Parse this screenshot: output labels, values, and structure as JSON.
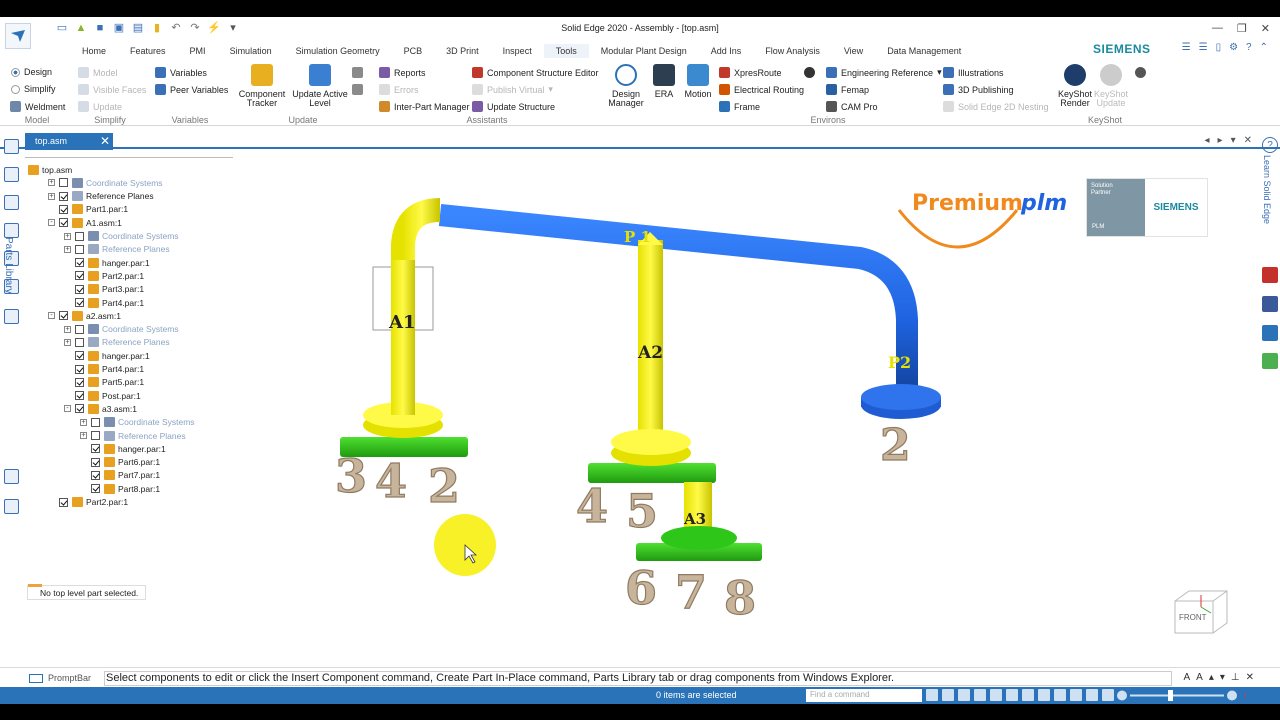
{
  "window": {
    "title": "Solid Edge 2020 - Assembly - [top.asm]"
  },
  "brand": {
    "name": "SIEMENS"
  },
  "tabs": [
    "Home",
    "Features",
    "PMI",
    "Simulation",
    "Simulation Geometry",
    "PCB",
    "3D Print",
    "Inspect",
    "Tools",
    "Modular Plant Design",
    "Add Ins",
    "Flow Analysis",
    "View",
    "Data Management"
  ],
  "active_tab": "Tools",
  "ribbon": {
    "model": {
      "design": "Design",
      "simplify": "Simplify",
      "weldment": "Weldment",
      "group": "Model"
    },
    "simplify": {
      "model": "Model",
      "visible_faces": "Visible Faces",
      "update": "Update",
      "group": "Simplify"
    },
    "variables": {
      "variables": "Variables",
      "peer_variables": "Peer Variables",
      "group": "Variables"
    },
    "update": {
      "component_tracker": "Component Tracker",
      "update_active_level": "Update Active Level",
      "group": "Update"
    },
    "assistants": {
      "reports": "Reports",
      "errors": "Errors",
      "inter_part_manager": "Inter-Part Manager",
      "cse": "Component Structure Editor",
      "publish_virtual": "Publish Virtual",
      "update_structure": "Update Structure",
      "group": "Assistants"
    },
    "environs": {
      "design_manager": "Design Manager",
      "era": "ERA",
      "motion": "Motion",
      "xpresroute": "XpresRoute",
      "electrical_routing": "Electrical Routing",
      "frame": "Frame",
      "engineering_reference": "Engineering Reference",
      "femap": "Femap",
      "cam_pro": "CAM Pro",
      "illustrations": "Illustrations",
      "publishing_3d": "3D Publishing",
      "nesting": "Solid Edge 2D Nesting",
      "group": "Environs"
    },
    "keyshot": {
      "render": "KeyShot Render",
      "update": "KeyShot Update",
      "group": "KeyShot"
    }
  },
  "document_tab": {
    "label": "top.asm"
  },
  "tree": [
    {
      "label": "top.asm",
      "level": 0,
      "checked": null,
      "expand": "",
      "grey": false,
      "icon": "asm"
    },
    {
      "label": "Coordinate Systems",
      "level": 1,
      "checked": false,
      "expand": "+",
      "grey": true,
      "icon": "cs"
    },
    {
      "label": "Reference Planes",
      "level": 1,
      "checked": true,
      "expand": "+",
      "grey": false,
      "icon": "rp"
    },
    {
      "label": "Part1.par:1",
      "level": 1,
      "checked": true,
      "expand": "",
      "grey": false,
      "icon": "part"
    },
    {
      "label": "A1.asm:1",
      "level": 1,
      "checked": true,
      "expand": "-",
      "grey": false,
      "icon": "asm"
    },
    {
      "label": "Coordinate Systems",
      "level": 2,
      "checked": false,
      "expand": "+",
      "grey": true,
      "icon": "cs"
    },
    {
      "label": "Reference Planes",
      "level": 2,
      "checked": false,
      "expand": "+",
      "grey": true,
      "icon": "rp"
    },
    {
      "label": "hanger.par:1",
      "level": 2,
      "checked": true,
      "expand": "",
      "grey": false,
      "icon": "part"
    },
    {
      "label": "Part2.par:1",
      "level": 2,
      "checked": true,
      "expand": "",
      "grey": false,
      "icon": "part"
    },
    {
      "label": "Part3.par:1",
      "level": 2,
      "checked": true,
      "expand": "",
      "grey": false,
      "icon": "part"
    },
    {
      "label": "Part4.par:1",
      "level": 2,
      "checked": true,
      "expand": "",
      "grey": false,
      "icon": "part"
    },
    {
      "label": "a2.asm:1",
      "level": 1,
      "checked": true,
      "expand": "-",
      "grey": false,
      "icon": "asm"
    },
    {
      "label": "Coordinate Systems",
      "level": 2,
      "checked": false,
      "expand": "+",
      "grey": true,
      "icon": "cs"
    },
    {
      "label": "Reference Planes",
      "level": 2,
      "checked": false,
      "expand": "+",
      "grey": true,
      "icon": "rp"
    },
    {
      "label": "hanger.par:1",
      "level": 2,
      "checked": true,
      "expand": "",
      "grey": false,
      "icon": "part"
    },
    {
      "label": "Part4.par:1",
      "level": 2,
      "checked": true,
      "expand": "",
      "grey": false,
      "icon": "part"
    },
    {
      "label": "Part5.par:1",
      "level": 2,
      "checked": true,
      "expand": "",
      "grey": false,
      "icon": "part"
    },
    {
      "label": "Post.par:1",
      "level": 2,
      "checked": true,
      "expand": "",
      "grey": false,
      "icon": "part"
    },
    {
      "label": "a3.asm:1",
      "level": 2,
      "checked": true,
      "expand": "-",
      "grey": false,
      "icon": "asm"
    },
    {
      "label": "Coordinate Systems",
      "level": 3,
      "checked": false,
      "expand": "+",
      "grey": true,
      "icon": "cs"
    },
    {
      "label": "Reference Planes",
      "level": 3,
      "checked": false,
      "expand": "+",
      "grey": true,
      "icon": "rp"
    },
    {
      "label": "hanger.par:1",
      "level": 3,
      "checked": true,
      "expand": "",
      "grey": false,
      "icon": "part"
    },
    {
      "label": "Part6.par:1",
      "level": 3,
      "checked": true,
      "expand": "",
      "grey": false,
      "icon": "part"
    },
    {
      "label": "Part7.par:1",
      "level": 3,
      "checked": true,
      "expand": "",
      "grey": false,
      "icon": "part"
    },
    {
      "label": "Part8.par:1",
      "level": 3,
      "checked": true,
      "expand": "",
      "grey": false,
      "icon": "part"
    },
    {
      "label": "Part2.par:1",
      "level": 1,
      "checked": true,
      "expand": "",
      "grey": false,
      "icon": "part"
    }
  ],
  "tree_status": "No top level part selected.",
  "side_labels": {
    "parts_library": "Parts Library",
    "learn": "Learn Solid Edge"
  },
  "model_labels": {
    "a1": "A1",
    "a2": "A2",
    "a3": "A3",
    "p1": "P 1",
    "p2": "P2",
    "n3": "3",
    "n4": "4",
    "n2": "2",
    "n4b": "4",
    "n5": "5",
    "n2b": "2",
    "n6": "6",
    "n7": "7",
    "n8": "8"
  },
  "partner_logo": {
    "premium": "Premium",
    "plm": "plm",
    "solution": "Solution",
    "partner": "Partner",
    "plm_small": "PLM",
    "siemens": "SIEMENS"
  },
  "view_cube": {
    "label": "FRONT"
  },
  "prompt_bar": {
    "label": "PromptBar",
    "message": "Select components to edit or click the Insert Component command, Create Part In-Place command, Parts Library tab or drag components from Windows Explorer."
  },
  "status_bar": {
    "items_selected": "0 items are selected",
    "find_placeholder": "Find a command"
  },
  "colors": {
    "accent": "#2a73b9",
    "yellow_part": "#f2ef1f",
    "blue_pipe": "#1f63e0",
    "green_part": "#2fc61a",
    "digits": "#c8b49a"
  }
}
